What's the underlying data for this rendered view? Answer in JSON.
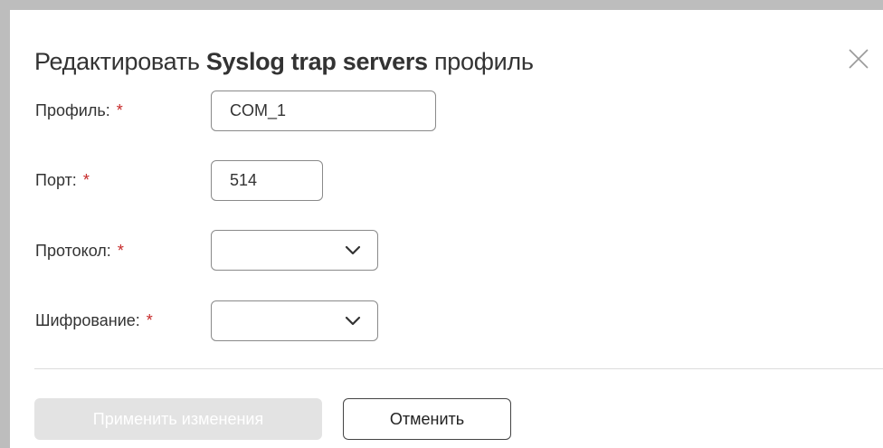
{
  "dialog": {
    "title_prefix": "Редактировать ",
    "title_bold": "Syslog trap servers",
    "title_suffix": " профиль",
    "close_icon": "close-icon"
  },
  "form": {
    "profile": {
      "label": "Профиль:",
      "required_mark": "*",
      "value": "COM_1"
    },
    "port": {
      "label": "Порт:",
      "required_mark": "*",
      "value": "514"
    },
    "protocol": {
      "label": "Протокол:",
      "required_mark": "*",
      "value": ""
    },
    "encryption": {
      "label": "Шифрование:",
      "required_mark": "*",
      "value": ""
    }
  },
  "actions": {
    "apply_label": "Применить изменения",
    "cancel_label": "Отменить"
  },
  "colors": {
    "required": "#c62828",
    "apply_disabled_bg": "#e3e3e3",
    "backdrop": "#bdbdbd"
  }
}
